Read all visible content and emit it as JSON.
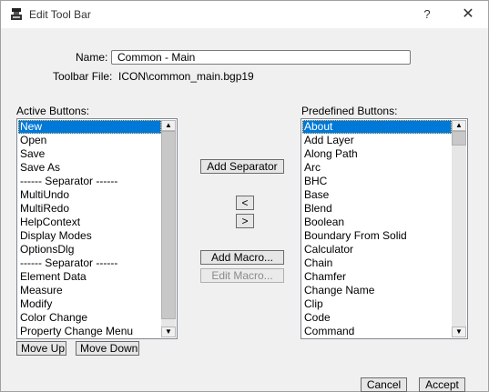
{
  "window": {
    "title": "Edit Tool Bar",
    "help_glyph": "?",
    "close_glyph": "✕"
  },
  "form": {
    "name_label": "Name:",
    "name_value": "Common - Main",
    "toolbar_file_label": "Toolbar File:",
    "toolbar_file_value": "ICON\\common_main.bgp19"
  },
  "active": {
    "label": "Active Buttons:",
    "selected": "New",
    "items": [
      "New",
      "Open",
      "Save",
      "Save As",
      "------ Separator ------",
      "MultiUndo",
      "MultiRedo",
      "HelpContext",
      "Display Modes",
      "OptionsDlg",
      "------ Separator ------",
      "Element Data",
      "Measure",
      "Modify",
      "Color Change",
      "Property Change Menu"
    ]
  },
  "predefined": {
    "label": "Predefined Buttons:",
    "selected": "About",
    "items": [
      "About",
      "Add Layer",
      "Along Path",
      "Arc",
      "BHC",
      "Base",
      "Blend",
      "Boolean",
      "Boundary From Solid",
      "Calculator",
      "Chain",
      "Chamfer",
      "Change Name",
      "Clip",
      "Code",
      "Command"
    ]
  },
  "buttons": {
    "add_separator": "Add Separator",
    "move_left": "<",
    "move_right": ">",
    "add_macro": "Add Macro...",
    "edit_macro": "Edit Macro...",
    "move_up": "Move Up",
    "move_down": "Move Down",
    "cancel": "Cancel",
    "accept": "Accept"
  },
  "icons": {
    "app": "toolbar-app-icon",
    "scroll_up": "▲",
    "scroll_down": "▼"
  },
  "colors": {
    "selection": "#0078d7",
    "window_bg": "#f0f0f0"
  }
}
